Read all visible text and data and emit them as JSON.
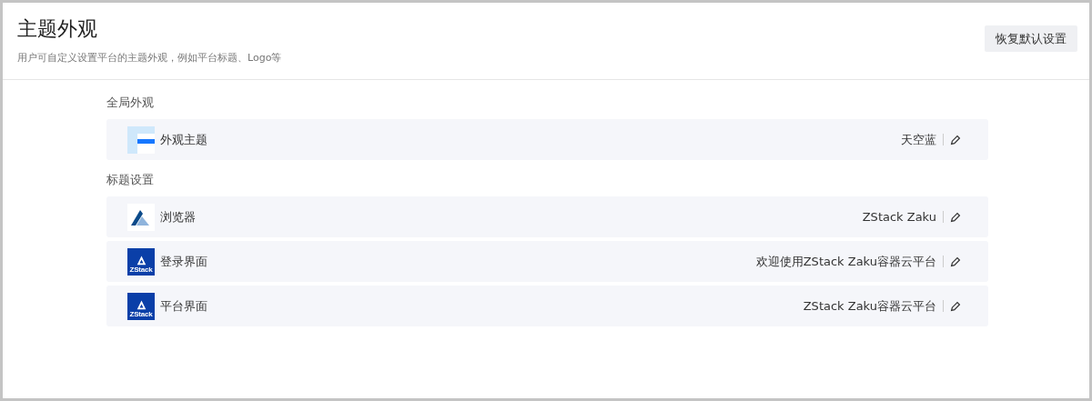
{
  "header": {
    "title": "主题外观",
    "subtitle": "用户可自定义设置平台的主题外观，例如平台标题、Logo等",
    "reset_button": "恢复默认设置"
  },
  "sections": [
    {
      "title": "全局外观",
      "rows": [
        {
          "kind": "theme",
          "label": "外观主题",
          "value": "天空蓝"
        }
      ]
    },
    {
      "title": "标题设置",
      "rows": [
        {
          "kind": "browser",
          "label": "浏览器",
          "value": "ZStack Zaku"
        },
        {
          "kind": "logo",
          "logo_text": "ZStack",
          "label": "登录界面",
          "value": "欢迎使用ZStack Zaku容器云平台"
        },
        {
          "kind": "logo",
          "logo_text": "ZStack",
          "label": "平台界面",
          "value": "ZStack Zaku容器云平台"
        }
      ]
    }
  ]
}
